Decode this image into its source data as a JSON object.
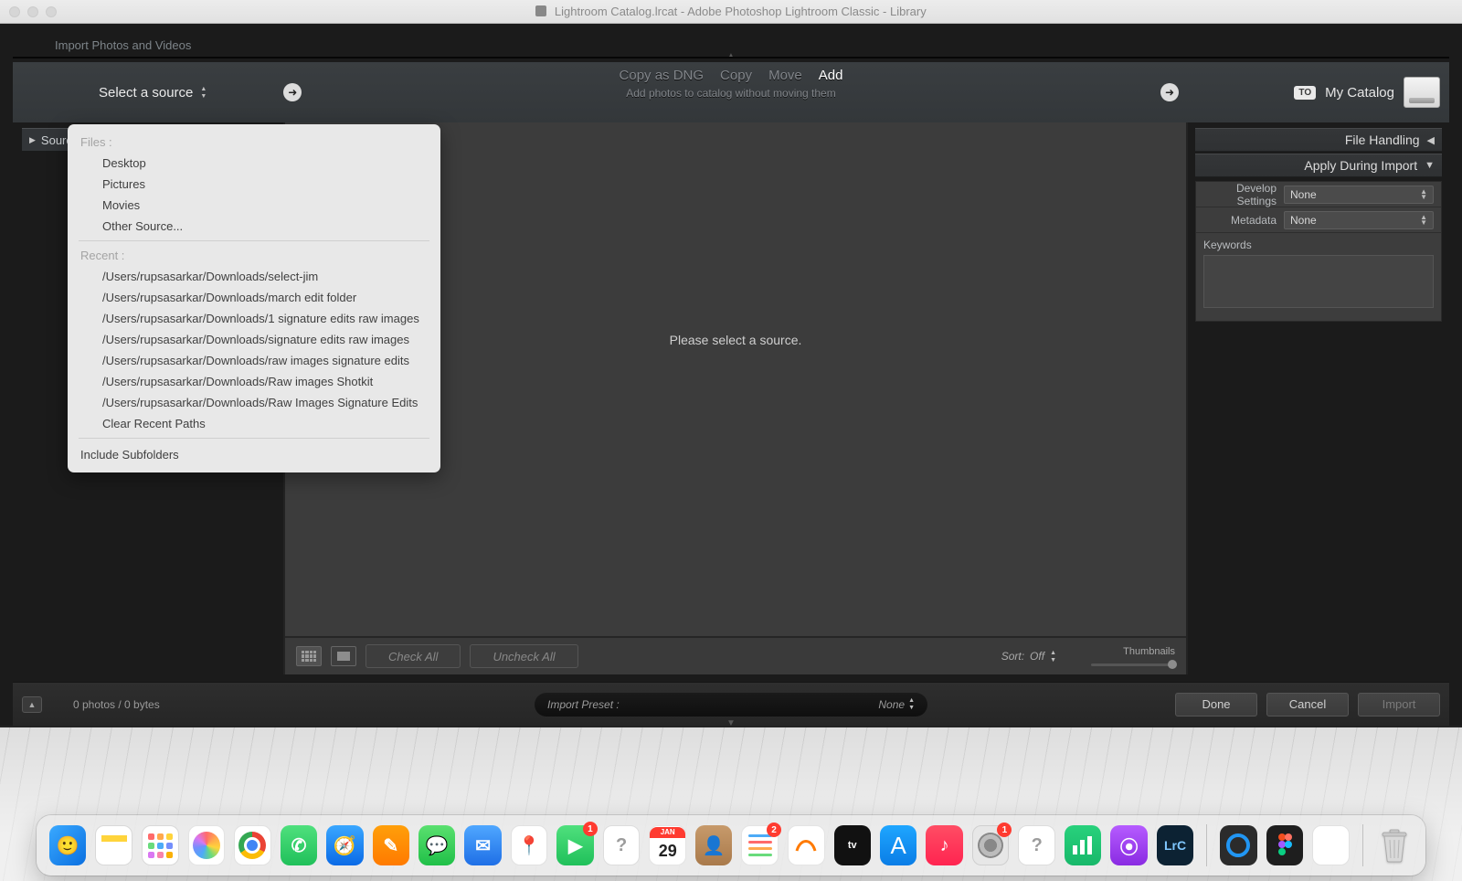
{
  "titlebar": {
    "text": "Lightroom Catalog.lrcat - Adobe Photoshop Lightroom Classic - Library"
  },
  "dialog": {
    "title": "Import Photos and Videos",
    "source_label": "Select a source",
    "dest_to": "TO",
    "dest_label": "My Catalog",
    "modes": [
      "Copy as DNG",
      "Copy",
      "Move",
      "Add"
    ],
    "mode_active": 3,
    "mode_sub": "Add photos to catalog without moving them",
    "left_header": "Source",
    "center_message": "Please select a source.",
    "check_all": "Check All",
    "uncheck_all": "Uncheck All",
    "sort_label": "Sort:",
    "sort_value": "Off",
    "thumb_label": "Thumbnails",
    "right": {
      "p1": "File Handling",
      "p2": "Apply During Import",
      "dev_label": "Develop Settings",
      "dev_val": "None",
      "meta_label": "Metadata",
      "meta_val": "None",
      "kw_label": "Keywords"
    },
    "bottom": {
      "info": "0 photos / 0 bytes",
      "preset_label": "Import Preset :",
      "preset_val": "None",
      "done": "Done",
      "cancel": "Cancel",
      "import": "Import"
    },
    "popup": {
      "sec1": "Files :",
      "files": [
        "Desktop",
        "Pictures",
        "Movies",
        "Other Source..."
      ],
      "sec2": "Recent :",
      "recent": [
        "/Users/rupsasarkar/Downloads/select-jim",
        "/Users/rupsasarkar/Downloads/march edit folder",
        "/Users/rupsasarkar/Downloads/1 signature edits raw images",
        "/Users/rupsasarkar/Downloads/signature edits raw images",
        "/Users/rupsasarkar/Downloads/raw images signature edits",
        "/Users/rupsasarkar/Downloads/Raw images Shotkit",
        "/Users/rupsasarkar/Downloads/Raw Images Signature Edits",
        "Clear Recent Paths"
      ],
      "include": "Include Subfolders"
    }
  },
  "cal": {
    "month": "JAN",
    "day": "29"
  },
  "dock_badges": {
    "facetime": "1",
    "reminders": "2",
    "settings": "1"
  }
}
